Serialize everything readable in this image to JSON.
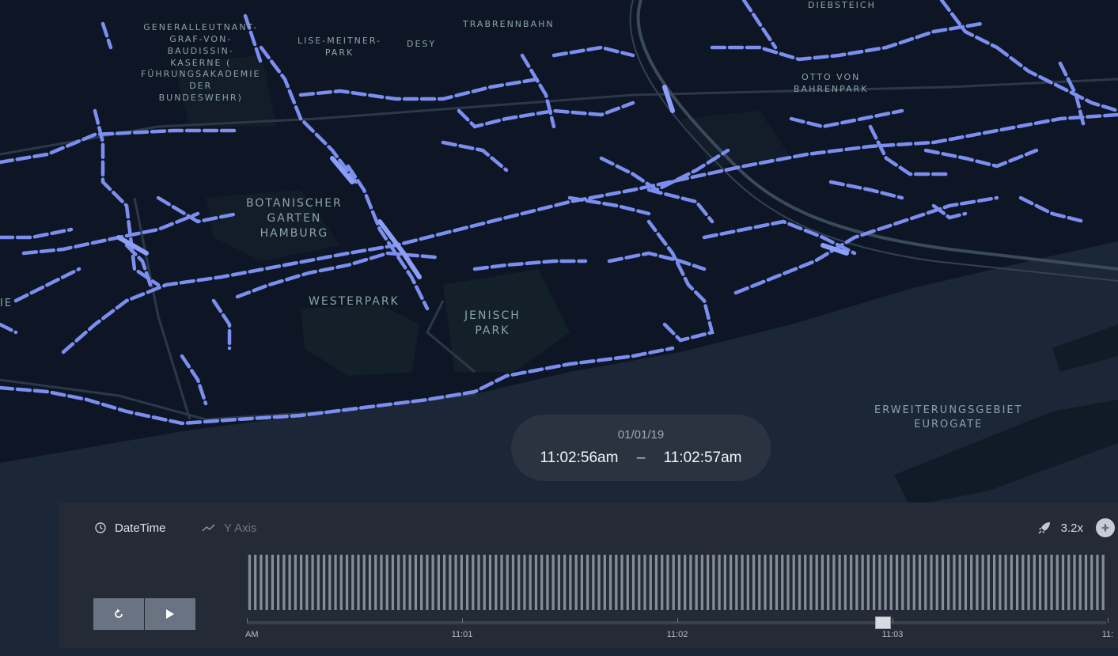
{
  "map": {
    "labels": {
      "generalleutnant": "GENERALLEUTNANT-\nGRAF-VON-\nBAUDISSIN-\nKASERNE (\nFÜHRUNGSAKADEMIE\nDER\nBUNDESWEHR)",
      "lise_meitner": "LISE-MEITNER-\nPARK",
      "desy": "DESY",
      "trabrennbahn": "TRABRENNBAHN",
      "diebsteich": "DIEBSTEICH",
      "otto_von_bahrenpark": "OTTO VON\nBAHRENPARK",
      "botanischer_garten": "BOTANISCHER\nGARTEN\nHAMBURG",
      "westerpark": "WESTERPARK",
      "jenisch_park": "JENISCH\nPARK",
      "erweiterungsgebiet": "ERWEITERUNGSGEBIET\nEUROGATE",
      "edge_left": "IE"
    },
    "colors": {
      "background": "#0e1626",
      "water": "#1b2636",
      "park": "#13202a",
      "road": "#2a3848",
      "trip": "#7c8ff0"
    }
  },
  "time_window": {
    "date": "01/01/19",
    "start": "11:02:56am",
    "end": "11:02:57am",
    "separator": "–"
  },
  "timeline": {
    "tabs": [
      {
        "label": "DateTime",
        "icon": "clock-icon",
        "active": true
      },
      {
        "label": "Y Axis",
        "icon": "line-chart-icon",
        "active": false
      }
    ],
    "speed": "3.2x",
    "speed_icon": "rocket-icon",
    "buttons": {
      "reset": "reset-icon",
      "play": "play-icon"
    },
    "axis_labels": [
      "AM",
      "11:01",
      "11:02",
      "11:03",
      "11:"
    ],
    "histogram_bar_count": 150,
    "playhead_position": 0.74,
    "colors": {
      "panel": "#242a36",
      "bar": "#858d99",
      "button": "#6a7381"
    }
  }
}
